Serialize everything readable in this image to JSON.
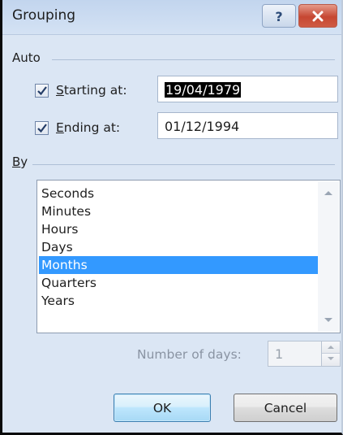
{
  "window": {
    "title": "Grouping",
    "help_label": "?",
    "close_label": "X"
  },
  "auto": {
    "group_label": "Auto",
    "starting": {
      "checked": true,
      "label_underlined": "S",
      "label_rest": "tarting at:",
      "value": "19/04/1979"
    },
    "ending": {
      "checked": true,
      "label_underlined": "E",
      "label_rest": "nding at:",
      "value": "01/12/1994"
    }
  },
  "by": {
    "group_label_underlined": "B",
    "group_label_rest": "y",
    "items": [
      "Seconds",
      "Minutes",
      "Hours",
      "Days",
      "Months",
      "Quarters",
      "Years"
    ],
    "selected": "Months"
  },
  "number_of_days": {
    "label": "Number of days:",
    "value": "1"
  },
  "buttons": {
    "ok": "OK",
    "cancel": "Cancel"
  },
  "colors": {
    "selection": "#3399ff",
    "dialog_bg": "#dbe6f4"
  },
  "icons": {
    "help": "question-mark-icon",
    "close": "close-x-icon"
  }
}
